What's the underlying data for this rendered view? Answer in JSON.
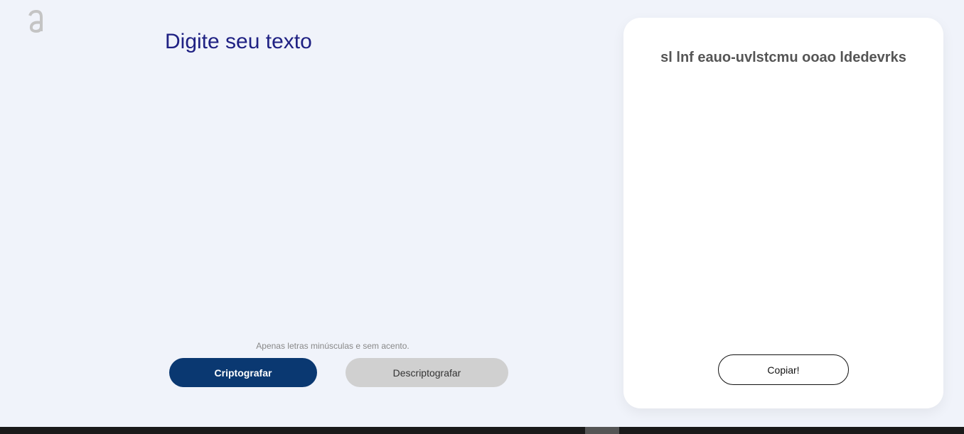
{
  "logo": {
    "icon": "alura-logo-icon",
    "color": "#c4c4c4"
  },
  "main": {
    "placeholder": "Digite seu texto",
    "input_value": "",
    "hint": "Apenas letras minúsculas e sem acento.",
    "encrypt_label": "Criptografar",
    "decrypt_label": "Descriptografar"
  },
  "output": {
    "text": "sl lnf eauo-uvlstcmu ooao ldedevrks",
    "copy_label": "Copiar!"
  },
  "colors": {
    "background": "#f0f3fa",
    "title": "#1f2183",
    "primary_button": "#0a3871",
    "secondary_button": "#d0d0d0",
    "card": "#ffffff"
  }
}
